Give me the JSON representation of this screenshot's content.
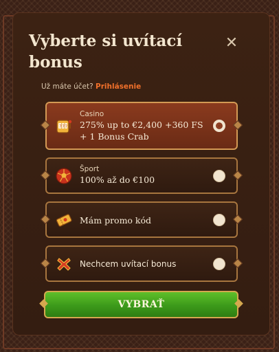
{
  "dialog": {
    "title": "Vyberte si uvítací bonus",
    "close_icon": "close-icon",
    "login_prompt": "Už máte účet?",
    "login_link": "Prihlásenie"
  },
  "options": [
    {
      "label": "Casino",
      "text_line1": "275% up to €2,400 +360 FS",
      "text_line2": "+ 1 Bonus Crab",
      "icon": "slot-machine-icon",
      "selected": true
    },
    {
      "label": "Šport",
      "text_line1": "100% až do €100",
      "icon": "soccer-ball-icon",
      "selected": false
    },
    {
      "text_line1": "Mám promo kód",
      "icon": "ticket-icon",
      "selected": false
    },
    {
      "text_line1": "Nechcem uvítací bonus",
      "icon": "red-x-icon",
      "selected": false
    }
  ],
  "submit_label": "VYBRAŤ",
  "colors": {
    "accent": "#f0702a",
    "selected_card": "#7a3219",
    "submit_green": "#3c9a1a",
    "gold_border": "#d5a84f"
  }
}
